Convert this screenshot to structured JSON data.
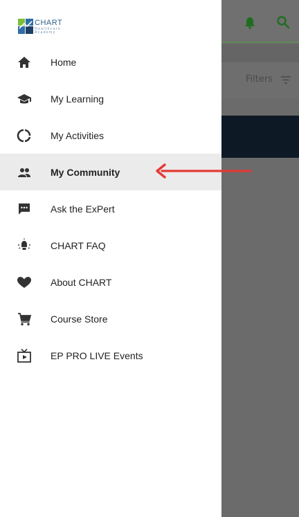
{
  "logo": {
    "name": "CHART",
    "sub1": "Healthcare",
    "sub2": "Academy",
    "colors": {
      "green": "#7bbf3a",
      "blue": "#2e6fa8",
      "dark": "#1e3f66"
    }
  },
  "menu": {
    "items": [
      {
        "label": "Home",
        "icon": "home-icon"
      },
      {
        "label": "My Learning",
        "icon": "graduation-cap-icon"
      },
      {
        "label": "My Activities",
        "icon": "circle-progress-icon"
      },
      {
        "label": "My Community",
        "icon": "people-icon",
        "active": true
      },
      {
        "label": "Ask the ExPert",
        "icon": "chat-bubble-icon"
      },
      {
        "label": "CHART FAQ",
        "icon": "lightbulb-icon"
      },
      {
        "label": "About CHART",
        "icon": "heart-icon"
      },
      {
        "label": "Course Store",
        "icon": "cart-icon"
      },
      {
        "label": "EP PRO LIVE Events",
        "icon": "live-tv-icon"
      }
    ]
  },
  "background": {
    "filters_label": "Filters",
    "accent": "#1f8a1f"
  },
  "annotation": {
    "color": "#e53935"
  }
}
